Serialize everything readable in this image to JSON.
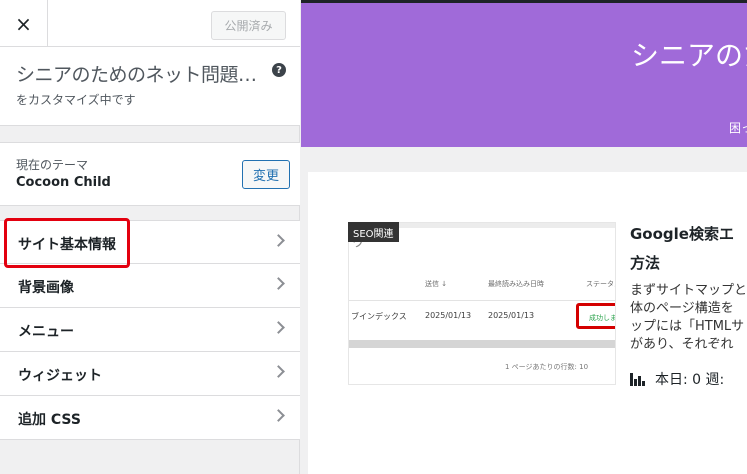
{
  "topbar": {
    "close_icon": "×",
    "publish_label": "公開済み"
  },
  "info": {
    "site_title": "シニアのためのネット問題…",
    "help_icon": "?",
    "customizing": "をカスタマイズ中です"
  },
  "theme": {
    "label": "現在のテーマ",
    "name": "Cocoon Child",
    "change_label": "変更"
  },
  "menu": {
    "items": [
      {
        "label": "サイト基本情報"
      },
      {
        "label": "背景画像"
      },
      {
        "label": "メニュー"
      },
      {
        "label": "ウィジェット"
      },
      {
        "label": "追加 CSS"
      }
    ]
  },
  "preview": {
    "header_title": "シニアのため",
    "header_sub": "困っ",
    "thumbnail": {
      "col_sent": "送信 ↓",
      "col_last_read": "最終読み込み日時",
      "col_status": "ステータス",
      "cell_name": "ブインデックス",
      "cell_sent": "2025/01/13",
      "cell_last_read": "2025/01/13",
      "cell_status": "成功しました",
      "rows_per_page": "1 ページあたりの行数:  10",
      "category": "SEO関連"
    },
    "post_title_lines": [
      "Google検索エ",
      "方法"
    ],
    "excerpt_lines": [
      "まずサイトマップと",
      "体のページ構造を",
      "ップには「HTMLサ",
      "があり、それぞれ"
    ],
    "stats_text": "本日: 0   週:"
  },
  "colors": {
    "header_bg": "#a06ad9",
    "highlight": "#e3000f",
    "accent": "#2271b1"
  }
}
